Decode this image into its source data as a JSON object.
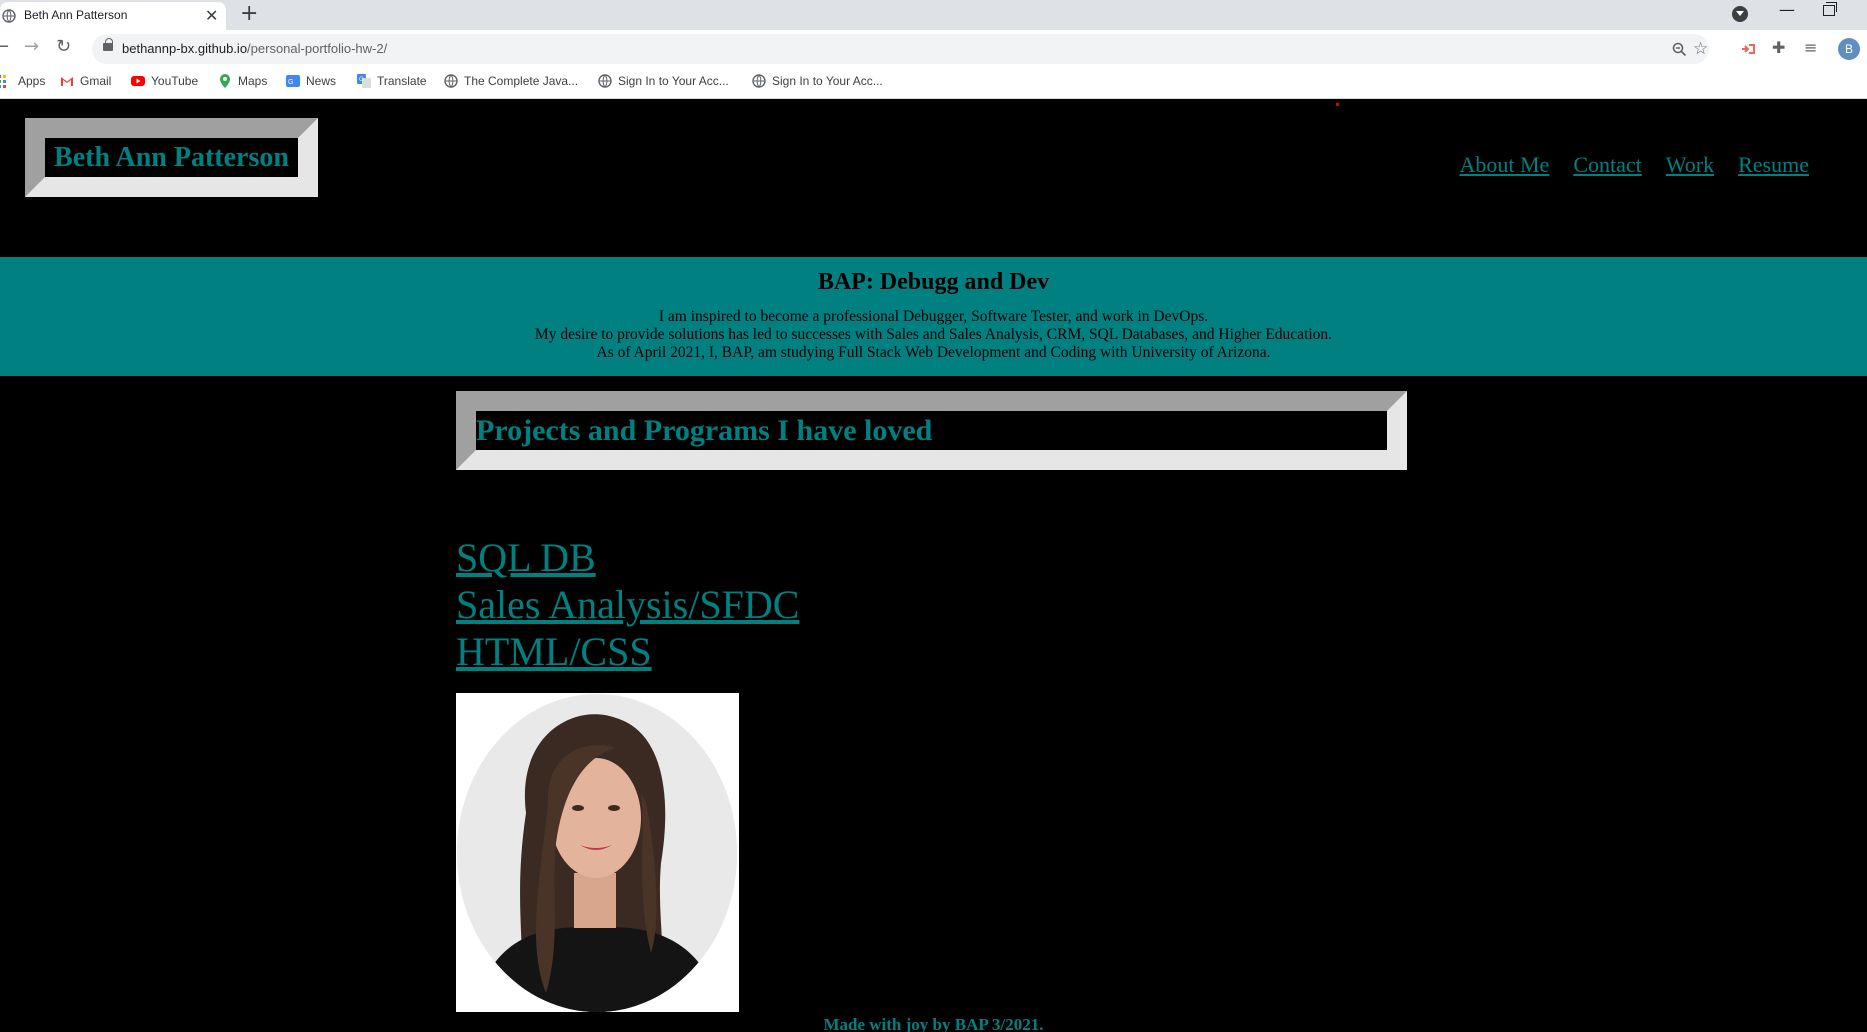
{
  "browser": {
    "tab_title": "Beth Ann Patterson",
    "tab_close": "✕",
    "new_tab": "+",
    "url_host": "bethannp-bx.github.io",
    "url_path": "/personal-portfolio-hw-2/",
    "profile_initial": "B",
    "window_minimize": "—",
    "bookmarks": [
      {
        "label": "Apps",
        "icon": "apps-grid-icon"
      },
      {
        "label": "Gmail",
        "icon": "gmail-icon"
      },
      {
        "label": "YouTube",
        "icon": "youtube-icon"
      },
      {
        "label": "Maps",
        "icon": "maps-pin-icon"
      },
      {
        "label": "News",
        "icon": "news-icon"
      },
      {
        "label": "Translate",
        "icon": "translate-icon"
      },
      {
        "label": "The Complete Java...",
        "icon": "globe-icon"
      },
      {
        "label": "Sign In to Your Acc...",
        "icon": "globe-icon"
      },
      {
        "label": "Sign In to Your Acc...",
        "icon": "globe-icon"
      }
    ]
  },
  "header": {
    "brand": "Beth Ann Patterson",
    "nav": [
      "About Me",
      "Contact",
      "Work",
      "Resume"
    ]
  },
  "hero": {
    "title": "BAP: Debugg and Dev",
    "line1": "I am inspired to become a professional Debugger, Software Tester, and work in DevOps.",
    "line2": "My desire to provide solutions has led to successes with Sales and Sales Analysis, CRM, SQL Databases, and Higher Education.",
    "line3": "As of April 2021, I, BAP, am studying Full Stack Web Development and Coding with University of Arizona."
  },
  "projects": {
    "title": "Projects and Programs I have loved",
    "links": [
      "SQL DB",
      "Sales Analysis/SFDC",
      "HTML/CSS"
    ]
  },
  "footer": {
    "text": "Made with joy by BAP 3/2021."
  },
  "colors": {
    "accent": "#008080",
    "background": "#000000",
    "frame_light": "#e6e6e6",
    "frame_dark": "#a0a0a0"
  }
}
